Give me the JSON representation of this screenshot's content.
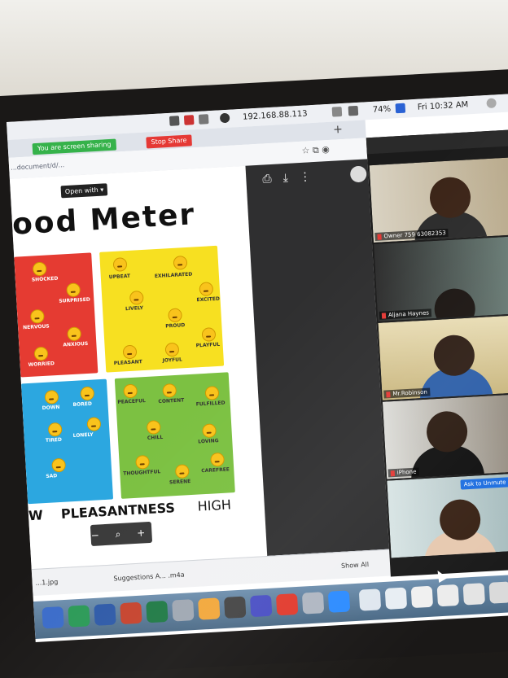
{
  "menubar": {
    "ip": "192.168.88.113",
    "battery": "74%",
    "clock": "Fri 10:32 AM"
  },
  "browser": {
    "share_banner": "You are screen sharing",
    "stop_share": "Stop Share",
    "url": "...document/d/...",
    "open_with": "Open with"
  },
  "document": {
    "title": "ood Meter",
    "red_labels": [
      "SHOCKED",
      "SURPRISED",
      "NERVOUS",
      "ANXIOUS",
      "WORRIED"
    ],
    "yellow_labels": [
      "UPBEAT",
      "EXHILARATED",
      "LIVELY",
      "EXCITED",
      "PROUD",
      "PLEASANT",
      "JOYFUL",
      "PLAYFUL"
    ],
    "blue_labels": [
      "DOWN",
      "BORED",
      "TIRED",
      "LONELY",
      "SAD"
    ],
    "green_labels": [
      "PEACEFUL",
      "CONTENT",
      "FULFILLED",
      "CHILL",
      "LOVING",
      "THOUGHTFUL",
      "SERENE",
      "CAREFREE"
    ],
    "axis_left": "W",
    "axis_mid": "PLEASANTNESS",
    "axis_right": "HIGH"
  },
  "downloads": {
    "item1": "...1.jpg",
    "item2": "Suggestions A... .m4a",
    "show_all": "Show All"
  },
  "zoom": {
    "participants": [
      {
        "name": "Owner 759 63082353"
      },
      {
        "name": "Aljana Haynes"
      },
      {
        "name": "Mr.Robinson"
      },
      {
        "name": "iPhone"
      },
      {
        "name": ""
      }
    ],
    "ask_button": "Ask to Unmute"
  }
}
